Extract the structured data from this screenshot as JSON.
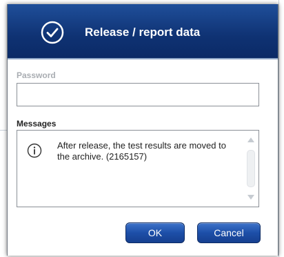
{
  "dialog": {
    "title": "Release / report data",
    "title_icon": "check-circle-icon"
  },
  "password": {
    "label": "Password",
    "value": "",
    "placeholder": ""
  },
  "messages": {
    "label": "Messages",
    "icon": "info-icon",
    "text": "After release, the test results are moved to the archive. (2165157)"
  },
  "buttons": {
    "ok_label": "OK",
    "cancel_label": "Cancel"
  },
  "colors": {
    "titlebar": "#0f3273",
    "button": "#1d4fa8",
    "disabled_label": "#a9adb2"
  }
}
